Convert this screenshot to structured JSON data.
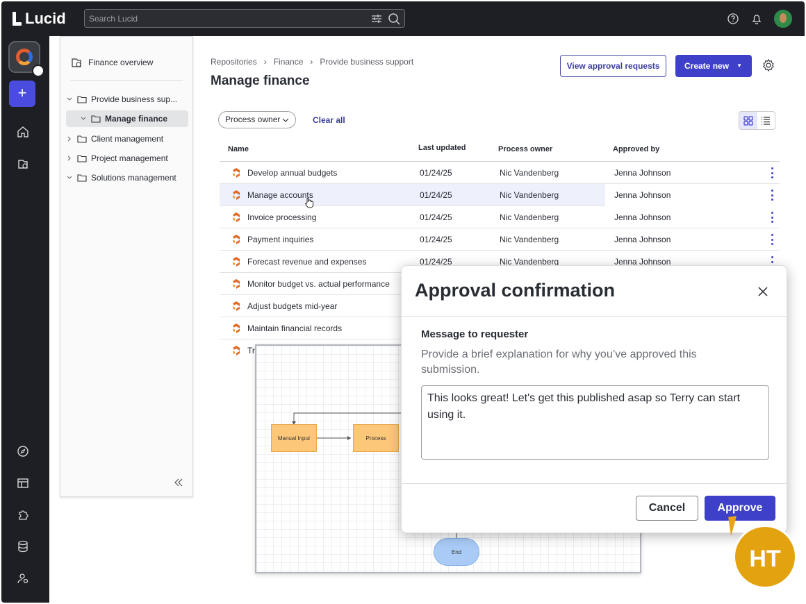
{
  "brand": {
    "name": "Lucid"
  },
  "search": {
    "placeholder": "Search Lucid"
  },
  "sidebar": {
    "header": "Finance overview",
    "tree": [
      {
        "label": "Provide business sup...",
        "expanded": true
      },
      {
        "label": "Manage finance",
        "selected": true
      },
      {
        "label": "Client management",
        "expanded": false
      },
      {
        "label": "Project management",
        "expanded": false
      },
      {
        "label": "Solutions management",
        "expanded": true
      }
    ]
  },
  "breadcrumb": [
    "Repositories",
    "Finance",
    "Provide business support"
  ],
  "page": {
    "title": "Manage finance"
  },
  "actions": {
    "view_approval": "View approval requests",
    "create_new": "Create new"
  },
  "filters": {
    "process_owner": "Process owner",
    "clear_all": "Clear all"
  },
  "table": {
    "columns": [
      "Name",
      "Last updated",
      "Process owner",
      "Approved by"
    ],
    "rows": [
      {
        "name": "Develop annual budgets",
        "updated": "01/24/25",
        "owner": "Nic Vandenberg",
        "approved": "Jenna Johnson"
      },
      {
        "name": "Manage accounts",
        "updated": "01/24/25",
        "owner": "Nic Vandenberg",
        "approved": "Jenna Johnson"
      },
      {
        "name": "Invoice processing",
        "updated": "01/24/25",
        "owner": "Nic Vandenberg",
        "approved": "Jenna Johnson"
      },
      {
        "name": "Payment inquiries",
        "updated": "01/24/25",
        "owner": "Nic Vandenberg",
        "approved": "Jenna Johnson"
      },
      {
        "name": "Forecast revenue and expenses",
        "updated": "01/24/25",
        "owner": "Nic Vandenberg",
        "approved": "Jenna Johnson"
      },
      {
        "name": "Monitor budget vs. actual performance",
        "updated": "",
        "owner": "",
        "approved": ""
      },
      {
        "name": "Adjust budgets mid-year",
        "updated": "",
        "owner": "",
        "approved": ""
      },
      {
        "name": "Maintain financial records",
        "updated": "",
        "owner": "",
        "approved": ""
      },
      {
        "name": "Tr",
        "updated": "",
        "owner": "",
        "approved": ""
      }
    ]
  },
  "diagram": {
    "shapes": [
      "Manual Input",
      "Process",
      "End"
    ]
  },
  "modal": {
    "title": "Approval confirmation",
    "label": "Message to requester",
    "help": "Provide a brief explanation for why you’ve approved this submission.",
    "message": "This looks great! Let's get this published asap so Terry can start using it.",
    "cancel": "Cancel",
    "approve": "Approve"
  },
  "collaborator": {
    "initials": "HT",
    "color": "#e3a20f"
  },
  "colors": {
    "accent": "#3f40c9",
    "dark": "#1e1f24"
  }
}
